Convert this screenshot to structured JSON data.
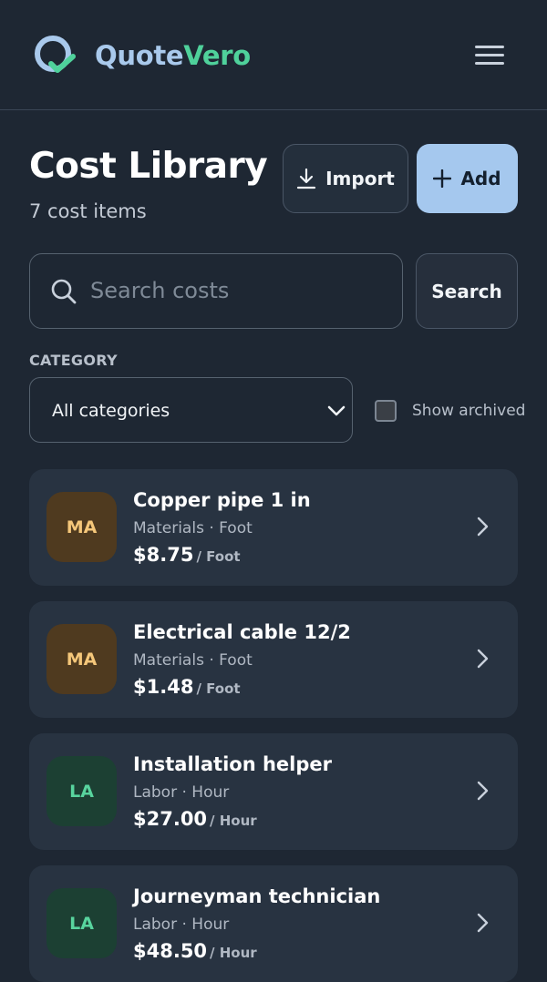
{
  "app": {
    "brand_first": "Quote",
    "brand_second": "Vero",
    "brand_colors": {
      "first": "#a9c9ec",
      "second": "#4fd19b"
    },
    "logo_icon": "q-check-logo",
    "menu_icon": "hamburger-menu-icon"
  },
  "page": {
    "title": "Cost Library",
    "count_text": "7 cost items"
  },
  "actions": {
    "import_label": "Import",
    "import_icon": "download-icon",
    "add_label": "Add",
    "add_icon": "plus-icon",
    "accent_color": "#a5c8ee"
  },
  "search": {
    "placeholder": "Search costs",
    "value": "",
    "button_label": "Search"
  },
  "filters": {
    "category_label": "CATEGORY",
    "category_selected": "All categories",
    "show_archived_label": "Show archived",
    "show_archived_checked": false
  },
  "items": [
    {
      "badge": "MA",
      "badge_kind": "materials",
      "name": "Copper pipe 1 in",
      "category": "Materials",
      "unit": "Foot",
      "subtitle": "Materials · Foot",
      "price": "$8.75",
      "price_unit": "/ Foot"
    },
    {
      "badge": "MA",
      "badge_kind": "materials",
      "name": "Electrical cable 12/2",
      "category": "Materials",
      "unit": "Foot",
      "subtitle": "Materials · Foot",
      "price": "$1.48",
      "price_unit": "/ Foot"
    },
    {
      "badge": "LA",
      "badge_kind": "labor",
      "name": "Installation helper",
      "category": "Labor",
      "unit": "Hour",
      "subtitle": "Labor · Hour",
      "price": "$27.00",
      "price_unit": "/ Hour"
    },
    {
      "badge": "LA",
      "badge_kind": "labor",
      "name": "Journeyman technician",
      "category": "Labor",
      "unit": "Hour",
      "subtitle": "Labor · Hour",
      "price": "$48.50",
      "price_unit": "/ Hour"
    }
  ]
}
